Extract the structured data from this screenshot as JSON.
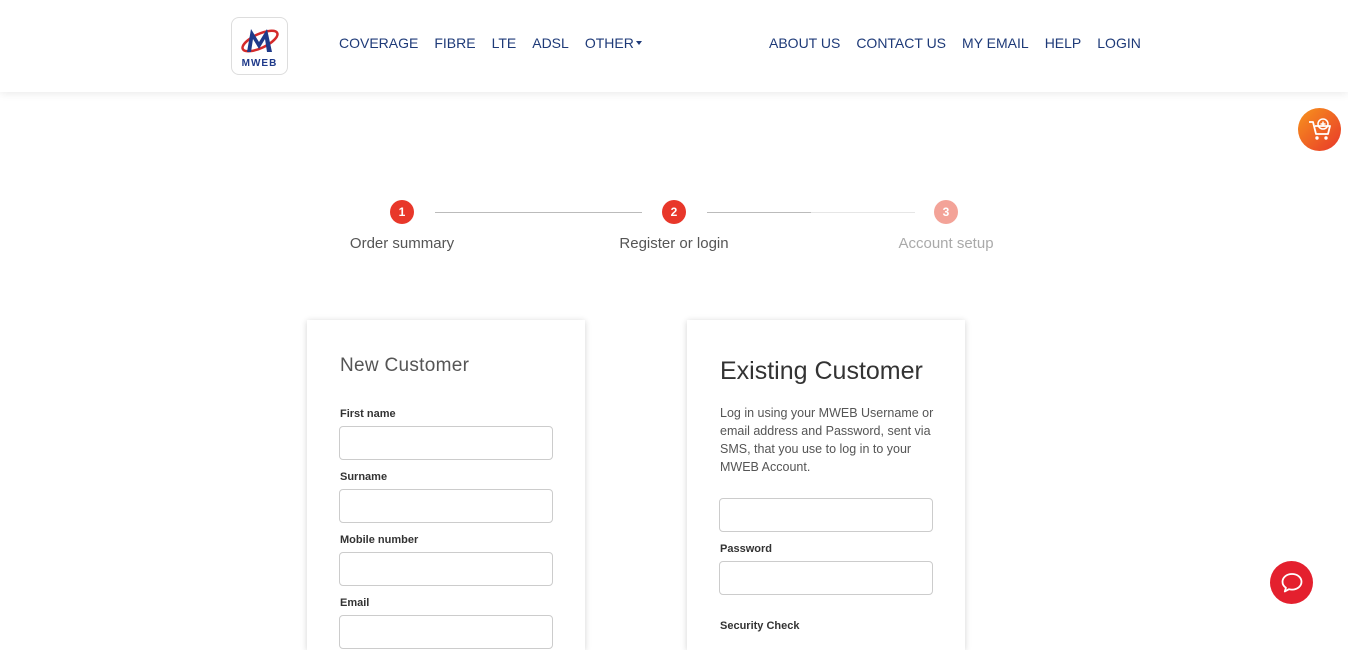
{
  "header": {
    "logo_text": "MWEB",
    "nav_left": [
      "COVERAGE",
      "FIBRE",
      "LTE",
      "ADSL",
      "OTHER"
    ],
    "nav_right": [
      "ABOUT US",
      "CONTACT US",
      "MY EMAIL",
      "HELP",
      "LOGIN"
    ]
  },
  "stepper": {
    "steps": [
      {
        "number": "1",
        "label": "Order summary"
      },
      {
        "number": "2",
        "label": "Register or login"
      },
      {
        "number": "3",
        "label": "Account setup"
      }
    ]
  },
  "new_customer": {
    "title": "New Customer",
    "fields": [
      "First name",
      "Surname",
      "Mobile number",
      "Email"
    ]
  },
  "existing_customer": {
    "title": "Existing Customer",
    "description": "Log in using your MWEB Username or email address and Password, sent via SMS, that you use to log in to your MWEB Account.",
    "password_label": "Password",
    "security_label": "Security Check"
  },
  "colors": {
    "accent": "#e8372a",
    "nav": "#1e3a78",
    "inactive_step": "#f3a398"
  },
  "icons": {
    "cart": "cart-add-icon",
    "chat": "chat-icon",
    "dropdown": "chevron-down-icon"
  }
}
